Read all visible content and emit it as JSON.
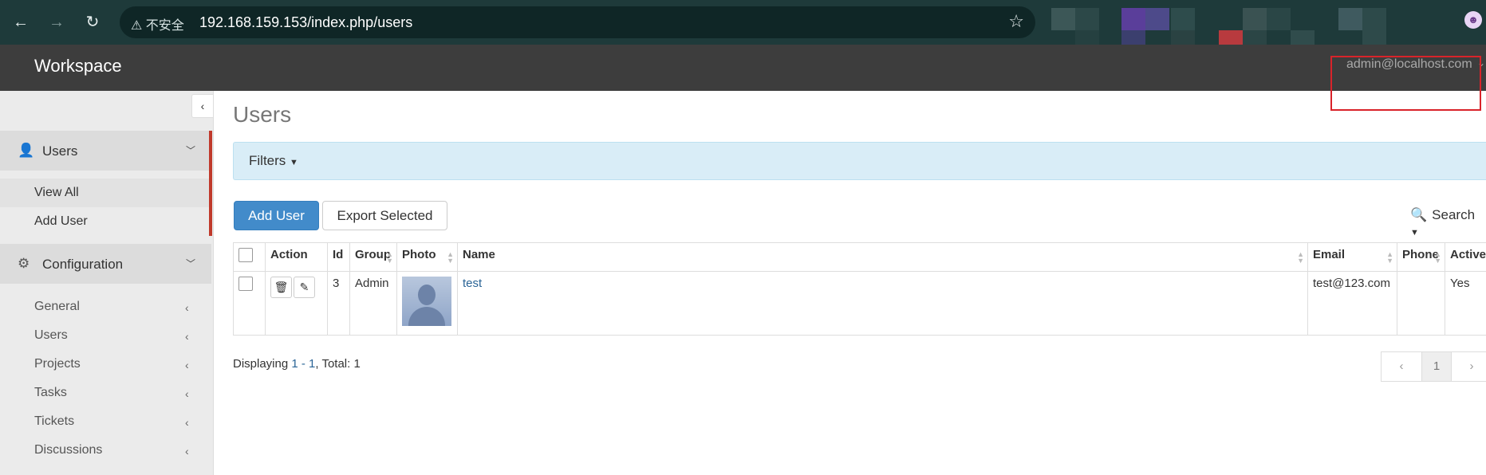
{
  "browser": {
    "back_icon": "arrow-left-icon",
    "forward_icon": "arrow-right-icon",
    "reload_icon": "reload-icon",
    "security_label": "不安全",
    "url": "192.168.159.153/index.php/users",
    "bookmark_icon": "star-icon"
  },
  "app": {
    "brand": "Workspace",
    "user_email": "admin@localhost.com"
  },
  "sidebar": {
    "users_section": {
      "label": "Users",
      "items": [
        {
          "label": "View All"
        },
        {
          "label": "Add User"
        }
      ]
    },
    "config_section": {
      "label": "Configuration",
      "items": [
        {
          "label": "General"
        },
        {
          "label": "Users"
        },
        {
          "label": "Projects"
        },
        {
          "label": "Tasks"
        },
        {
          "label": "Tickets"
        },
        {
          "label": "Discussions"
        }
      ]
    }
  },
  "main": {
    "title": "Users",
    "filters_label": "Filters",
    "add_user_label": "Add User",
    "export_label": "Export Selected",
    "search_label": "Search",
    "table": {
      "headers": [
        "Action",
        "Id",
        "Group",
        "Photo",
        "Name",
        "Email",
        "Phone",
        "Active"
      ],
      "rows": [
        {
          "id": "3",
          "group": "Admin",
          "name": "test",
          "email": "test@123.com",
          "phone": "",
          "active": "Yes"
        }
      ]
    },
    "footer": {
      "prefix": "Displaying ",
      "range": "1 - 1",
      "total_label": ", Total: 1"
    },
    "pagination": {
      "current": "1"
    }
  },
  "colors": {
    "accent": "#428bca",
    "active_bar": "#c0392b",
    "highlight_box": "#d9232a"
  }
}
